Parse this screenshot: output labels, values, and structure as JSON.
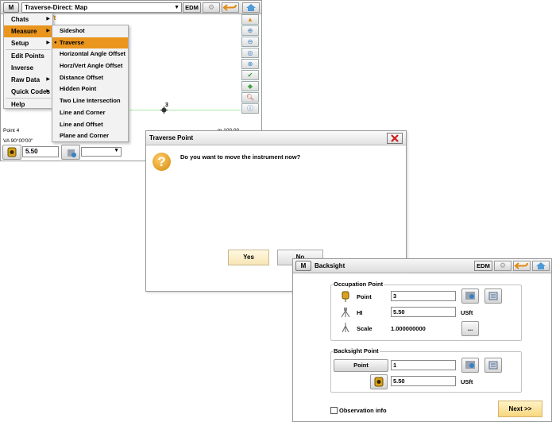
{
  "map_window": {
    "menu_button": "M",
    "title": "Traverse-Direct: Map",
    "edm_label": "EDM",
    "left_menu": [
      {
        "label": "Chats",
        "has_submenu": true,
        "selected": false
      },
      {
        "label": "Measure",
        "has_submenu": true,
        "selected": true
      },
      {
        "label": "Setup",
        "has_submenu": true,
        "selected": false
      },
      {
        "label": "Edit Points",
        "has_submenu": false,
        "selected": false
      },
      {
        "label": "Inverse",
        "has_submenu": false,
        "selected": false
      },
      {
        "label": "Raw Data",
        "has_submenu": true,
        "selected": false
      },
      {
        "label": "Quick Codes",
        "has_submenu": true,
        "selected": false
      },
      {
        "label": "Help",
        "has_submenu": false,
        "selected": false
      }
    ],
    "submenu": [
      {
        "label": "Sideshot",
        "selected": false
      },
      {
        "label": "Traverse",
        "selected": true
      },
      {
        "label": "Horizontal Angle Offset",
        "selected": false
      },
      {
        "label": "Horz/Vert Angle Offset",
        "selected": false
      },
      {
        "label": "Distance Offset",
        "selected": false
      },
      {
        "label": "Hidden Point",
        "selected": false
      },
      {
        "label": "Two Line Intersection",
        "selected": false
      },
      {
        "label": "Line and Corner",
        "selected": false
      },
      {
        "label": "Line and Offset",
        "selected": false
      },
      {
        "label": "Plane and Corner",
        "selected": false
      }
    ],
    "map_unit_fragment": "ft",
    "map_point_label": "3",
    "status_point": "Point 4",
    "status_va": "VA 90°00'00\"",
    "status_right": "m 100.00",
    "hi_value": "5.50"
  },
  "traverse_dialog": {
    "title": "Traverse Point",
    "message": "Do you want to move the instrument now?",
    "yes_label": "Yes",
    "no_label": "No"
  },
  "backsight_window": {
    "menu_button": "M",
    "title": "Backsight",
    "edm_label": "EDM",
    "occupation": {
      "group_label": "Occupation Point",
      "point_label": "Point",
      "point_value": "3",
      "hi_label": "HI",
      "hi_value": "5.50",
      "hi_unit": "USft",
      "scale_label": "Scale",
      "scale_value": "1.000000000",
      "ellipsis_label": "..."
    },
    "backsight": {
      "group_label": "Backsight Point",
      "point_button": "Point",
      "point_value": "1",
      "height_value": "5.50",
      "height_unit": "USft"
    },
    "observation_label": "Observation info",
    "next_label": "Next >>"
  },
  "colors": {
    "menu_highlight": "#e9951e",
    "close_red": "#cc1f1f",
    "question_icon": "#e8a21e",
    "next_button": "#f8d77e"
  }
}
